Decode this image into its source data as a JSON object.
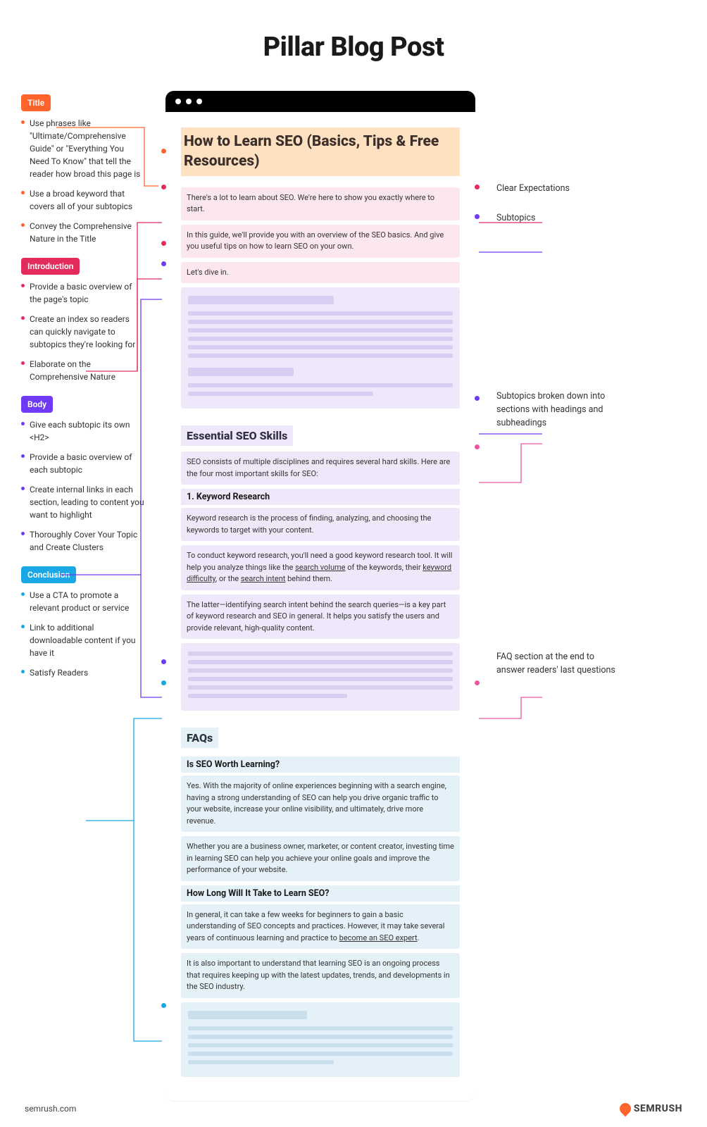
{
  "page_title": "Pillar Blog Post",
  "left": {
    "title": {
      "label": "Title",
      "color": "orange",
      "items": [
        "Use phrases like \"Ultimate/Comprehensive Guide\" or \"Everything You Need To Know\" that tell the reader how broad this page is",
        "Use a broad keyword that covers all of your subtopics",
        "Convey the Comprehensive Nature in the Title"
      ]
    },
    "intro": {
      "label": "Introduction",
      "color": "red",
      "items": [
        "Provide a basic overview of the page's topic",
        "Create an index so readers can quickly navigate to subtopics they're looking for",
        "Elaborate on the Comprehensive Nature"
      ]
    },
    "body": {
      "label": "Body",
      "color": "purple",
      "items": [
        "Give each subtopic its own <H2>",
        "Provide a basic overview of each subtopic",
        "Create internal links in each section, leading to content you want to highlight",
        "Thoroughly Cover Your Topic and Create Clusters"
      ]
    },
    "conclusion": {
      "label": "Conclusion",
      "color": "blue",
      "items": [
        "Use a CTA to promote a relevant product or service",
        "Link to additional downloadable content if you have it",
        "Satisfy Readers"
      ]
    }
  },
  "center": {
    "title": "How to Learn SEO (Basics, Tips & Free Resources)",
    "intro_paras": [
      "There's a lot to learn about SEO. We're here to show you exactly where to start.",
      "In this guide, we'll provide you with an overview of the SEO basics. And give you useful tips on how to learn SEO on your own.",
      "Let's dive in."
    ],
    "section1_h2": "Essential SEO Skills",
    "section1_intro": "SEO consists of multiple disciplines and requires several hard skills. Here are the four most important skills for SEO:",
    "section1_h3": "1. Keyword Research",
    "section1_paras": [
      "Keyword research is the process of finding, analyzing, and choosing the keywords to target with your content.",
      "To conduct keyword research, you'll need a good keyword research tool. It will help you analyze things like the search volume of the keywords, their keyword difficulty, or the search intent behind them.",
      "The latter—identifying search intent behind the search queries—is a key part of keyword research and SEO in general. It helps you satisfy the users and provide relevant, high-quality content."
    ],
    "faqs_h2": "FAQs",
    "faq1_q": "Is SEO Worth Learning?",
    "faq1_paras": [
      "Yes. With the majority of online experiences beginning with a search engine, having a strong understanding of SEO can help you drive organic traffic to your website, increase your online visibility, and ultimately, drive more revenue.",
      "Whether you are a business owner, marketer, or content creator, investing time in learning SEO can help you achieve your online goals and improve the performance of your website."
    ],
    "faq2_q": "How Long Will It Take to Learn SEO?",
    "faq2_paras": [
      "In general, it can take a few weeks for beginners to gain a basic understanding of SEO concepts and practices. However, it may take several years of continuous learning and practice to become an SEO expert.",
      "It is also important to understand that learning SEO is an ongoing process that requires keeping up with the latest updates, trends, and developments in the SEO industry."
    ]
  },
  "right": {
    "note1": "Clear Expectations",
    "note2": "Subtopics",
    "note3": "Subtopics broken down into sections with headings and subheadings",
    "note4": "FAQ section at the end to answer readers' last questions"
  },
  "footer": {
    "site": "semrush.com",
    "brand": "SEMRUSH"
  }
}
